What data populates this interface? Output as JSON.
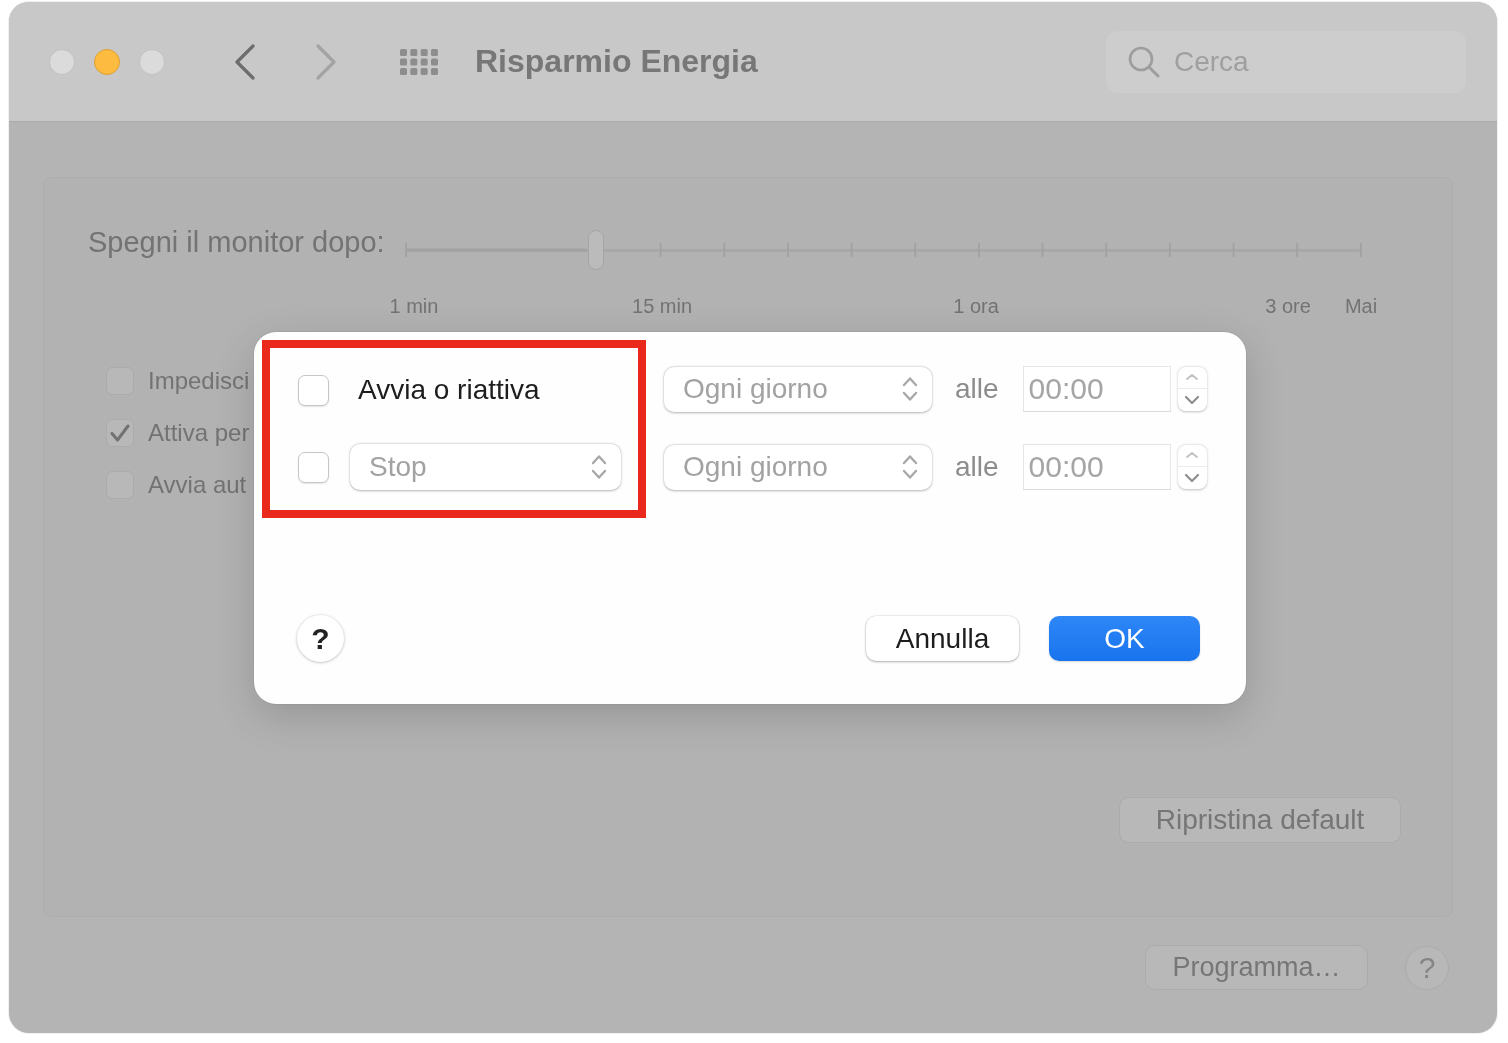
{
  "window": {
    "controls": [
      {
        "kind": "close",
        "enabled": false
      },
      {
        "kind": "minimize",
        "enabled": true
      },
      {
        "kind": "zoom",
        "enabled": false
      }
    ],
    "navigation": {
      "back_enabled": true,
      "forward_enabled": false
    },
    "title": "Risparmio Energia",
    "search": {
      "placeholder": "Cerca"
    }
  },
  "panel": {
    "display_sleep": {
      "label": "Spegni il monitor dopo:",
      "level": 0.2,
      "tick_labels": [
        "1 min",
        "15 min",
        "1 ora",
        "3 ore",
        "Mai"
      ]
    },
    "options": [
      {
        "label": "Impedisci",
        "checked": false
      },
      {
        "label": "Attiva per",
        "checked": true
      },
      {
        "label": "Avvia aut",
        "checked": false
      }
    ],
    "restore_button": "Ripristina default"
  },
  "footer": {
    "schedule_button": "Programma…",
    "help_button": "?"
  },
  "sheet": {
    "highlight_frame": true,
    "rows": [
      {
        "kind": "label",
        "checked": false,
        "action": "Avvia o riattiva",
        "disabled": true,
        "repeat": "Ogni giorno",
        "at_label": "alle",
        "time": "00:00"
      },
      {
        "kind": "popup",
        "checked": false,
        "action": "Stop",
        "disabled": true,
        "repeat": "Ogni giorno",
        "at_label": "alle",
        "time": "00:00"
      }
    ],
    "help_button": "?",
    "buttons": [
      {
        "label": "Annulla",
        "kind": "cancel"
      },
      {
        "label": "OK",
        "kind": "confirm"
      }
    ]
  }
}
